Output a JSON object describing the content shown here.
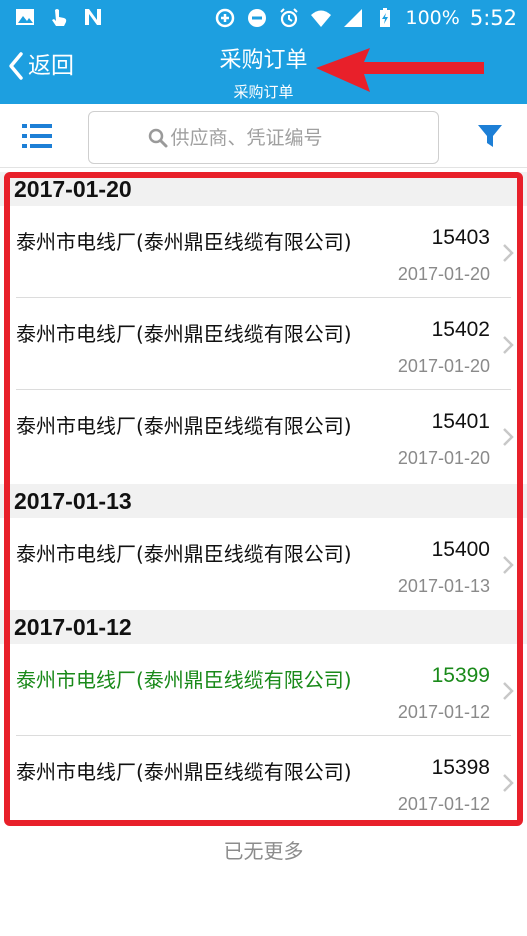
{
  "status_bar": {
    "battery": "100%",
    "time": "5:52"
  },
  "nav": {
    "back_label": "返回",
    "title": "采购订单",
    "subtitle": "采购订单"
  },
  "search": {
    "placeholder": "供应商、凭证编号"
  },
  "sections": [
    {
      "date": "2017-01-20",
      "rows": [
        {
          "name": "泰州市电线厂(泰州鼎臣线缆有限公司)",
          "number": "15403",
          "date": "2017-01-20"
        },
        {
          "name": "泰州市电线厂(泰州鼎臣线缆有限公司)",
          "number": "15402",
          "date": "2017-01-20"
        },
        {
          "name": "泰州市电线厂(泰州鼎臣线缆有限公司)",
          "number": "15401",
          "date": "2017-01-20"
        }
      ]
    },
    {
      "date": "2017-01-13",
      "rows": [
        {
          "name": "泰州市电线厂(泰州鼎臣线缆有限公司)",
          "number": "15400",
          "date": "2017-01-13"
        }
      ]
    },
    {
      "date": "2017-01-12",
      "rows": [
        {
          "name": "泰州市电线厂(泰州鼎臣线缆有限公司)",
          "number": "15399",
          "date": "2017-01-12"
        },
        {
          "name": "泰州市电线厂(泰州鼎臣线缆有限公司)",
          "number": "15398",
          "date": "2017-01-12"
        }
      ]
    }
  ],
  "footer": {
    "no_more": "已无更多"
  },
  "colors": {
    "brand": "#1d9fe0",
    "highlight": "#1a8a1a",
    "annotation": "#e8202a"
  }
}
